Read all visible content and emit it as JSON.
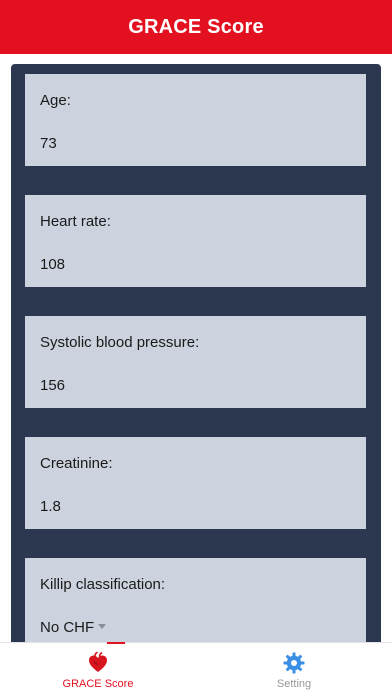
{
  "header": {
    "title": "GRACE Score"
  },
  "fields": [
    {
      "label": "Age:",
      "value": "73"
    },
    {
      "label": "Heart rate:",
      "value": "108"
    },
    {
      "label": "Systolic blood pressure:",
      "value": "156"
    },
    {
      "label": "Creatinine:",
      "value": "1.8"
    },
    {
      "label": "Killip classification:",
      "value": "No CHF"
    }
  ],
  "tabbar": {
    "tabs": [
      {
        "label": "GRACE Score",
        "icon": "heart-icon",
        "active": true
      },
      {
        "label": "Setting",
        "icon": "gear-icon",
        "active": false
      }
    ]
  },
  "colors": {
    "accent": "#e3101f",
    "panel": "#2c3850",
    "field_bg": "#ccd2de",
    "gear_blue": "#3a8ee6"
  }
}
